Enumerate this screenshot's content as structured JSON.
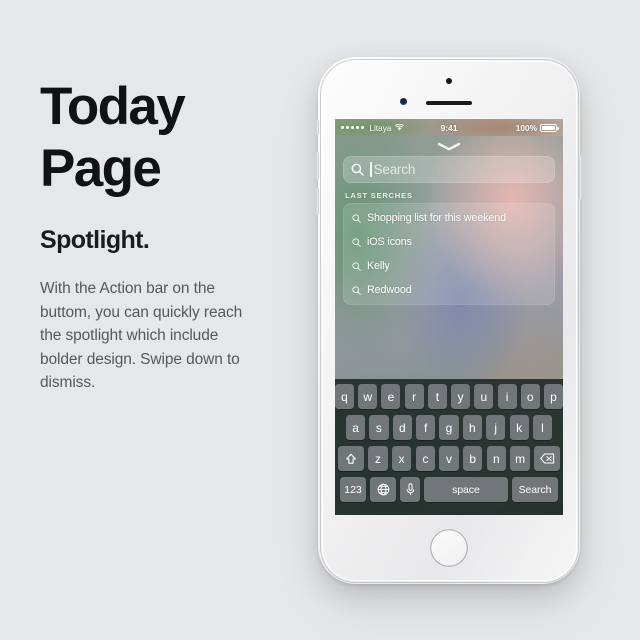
{
  "page": {
    "background_color": "#e5e7e9"
  },
  "left_panel": {
    "headline_line1": "Today",
    "headline_line2": "Page",
    "subhead": "Spotlight.",
    "body": "With the Action bar on the buttom, you can quickly reach the spotlight which include bolder design. Swipe down to dismiss.",
    "headline_color": "#111214",
    "body_color": "#56585c"
  },
  "phone": {
    "device": "iphone-white-silver",
    "camera_icon": "front-camera-dot",
    "sensor_icon": "proximity-sensor-dot",
    "earpiece_icon": "earpiece-speaker-slot",
    "home_button_label": "home-button",
    "side_buttons": [
      "silent-switch",
      "volume-up",
      "volume-down",
      "power"
    ]
  },
  "status_bar": {
    "signal_dots": 5,
    "carrier": "Litaya",
    "wifi_icon": "wifi-icon",
    "time": "9:41",
    "battery_percent": "100%",
    "battery_level": 100
  },
  "spotlight": {
    "handle_icon": "chevron-down-icon",
    "search": {
      "icon": "search-icon",
      "placeholder": "Search",
      "value": "",
      "caret_visible": true
    },
    "section_label": "LAST SERCHES",
    "results": [
      {
        "icon": "search-icon",
        "label": "Shopping list for this weekend"
      },
      {
        "icon": "search-icon",
        "label": "iOS icons"
      },
      {
        "icon": "search-icon",
        "label": "Kelly"
      },
      {
        "icon": "search-icon",
        "label": "Redwood"
      }
    ]
  },
  "keyboard": {
    "row1": [
      "q",
      "w",
      "e",
      "r",
      "t",
      "y",
      "u",
      "i",
      "o",
      "p"
    ],
    "row2": [
      "a",
      "s",
      "d",
      "f",
      "g",
      "h",
      "j",
      "k",
      "l"
    ],
    "row3": [
      "z",
      "x",
      "c",
      "v",
      "b",
      "n",
      "m"
    ],
    "shift_icon": "shift-arrow-icon",
    "backspace_icon": "backspace-delete-icon",
    "numbers_key": "123",
    "globe_icon": "globe-language-icon",
    "mic_icon": "microphone-icon",
    "space_key": "space",
    "search_key": "Search",
    "key_color": "#717679",
    "background_color": "#242e2a"
  }
}
